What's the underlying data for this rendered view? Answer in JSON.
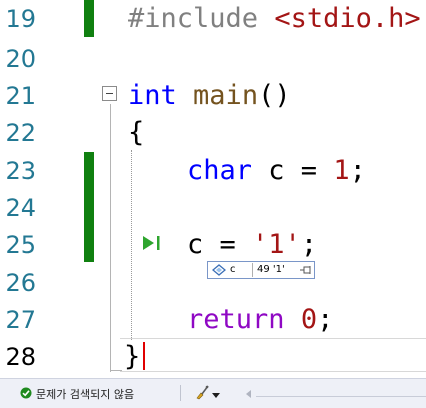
{
  "editor": {
    "line_numbers": [
      "19",
      "20",
      "21",
      "22",
      "23",
      "24",
      "25",
      "26",
      "27",
      "28"
    ],
    "lines": {
      "l19": {
        "directive": "#include",
        "header": "<stdio.h>"
      },
      "l21": {
        "type": "int",
        "name": "main",
        "parens": "()"
      },
      "l22": {
        "text": "{"
      },
      "l23": {
        "type": "char",
        "decl": " c = ",
        "value": "1",
        "end": ";"
      },
      "l25": {
        "lhs": "c = ",
        "value": "'1'",
        "end": ";"
      },
      "l27": {
        "keyword": "return",
        "value": "0",
        "end": ";"
      },
      "l28": {
        "text": "}"
      }
    }
  },
  "datatip": {
    "variable": "c",
    "value": "49 '1'",
    "icon": "variable-icon",
    "pin_icon": "pin-icon"
  },
  "status_bar": {
    "issues_text": "문제가 검색되지 않음",
    "ok_icon": "check-circle-icon",
    "brush_icon": "code-cleanup-brush-icon"
  },
  "colors": {
    "keyword": "#0000ff",
    "function": "#74531f",
    "string": "#a31515",
    "preprocessor": "#808080",
    "change_bar": "#108010",
    "caret": "#e00000",
    "line_number": "#237893"
  }
}
